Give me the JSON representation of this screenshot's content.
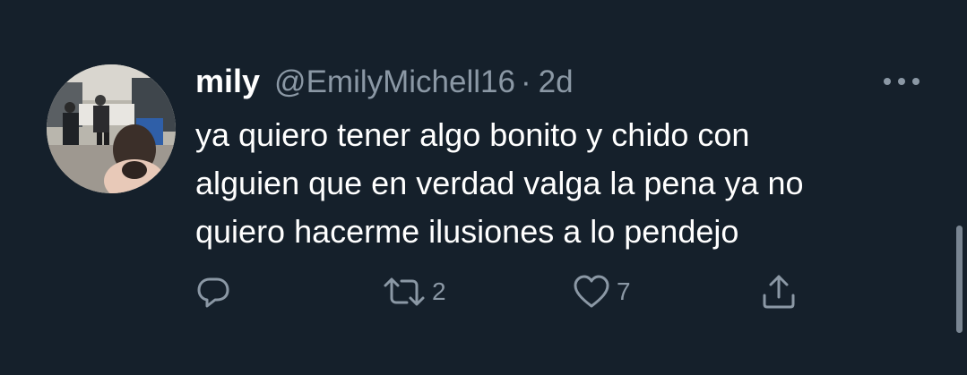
{
  "tweet": {
    "display_name": "mily",
    "handle": "@EmilyMichell16",
    "separator": "·",
    "time": "2d",
    "text": "ya quiero tener algo bonito y chido con\nalguien que en verdad valga la pena ya no\nquiero hacerme ilusiones a lo pendejo"
  },
  "actions": {
    "reply_icon": "reply-icon",
    "retweet_icon": "retweet-icon",
    "retweet_count": "2",
    "like_icon": "heart-icon",
    "like_count": "7",
    "share_icon": "share-icon"
  },
  "colors": {
    "background": "#15202b",
    "primary_text": "#ffffff",
    "secondary_text": "#8b98a5"
  }
}
